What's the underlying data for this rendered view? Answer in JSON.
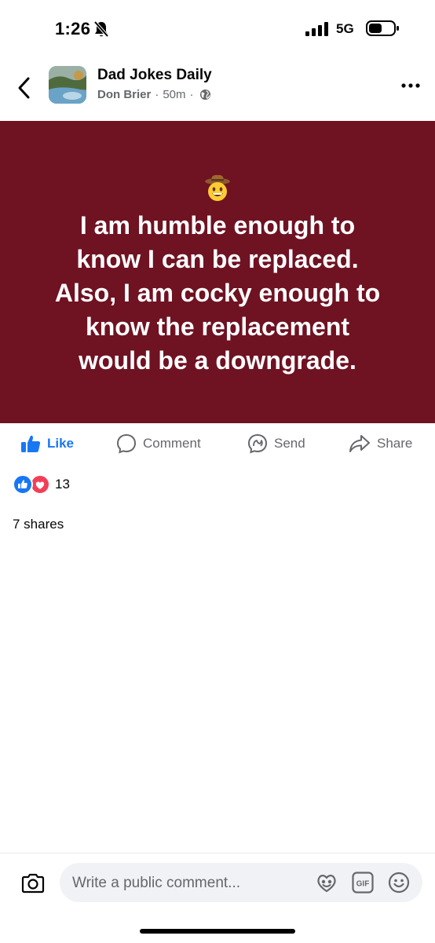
{
  "status_bar": {
    "time": "1:26",
    "network": "5G"
  },
  "header": {
    "group_name": "Dad Jokes Daily",
    "author": "Don Brier",
    "time_ago": "50m",
    "separator": "·"
  },
  "post": {
    "background_color": "#6f1222",
    "emoji": "cowboy-hat-face",
    "text": "I am humble enough to\nknow I can be replaced.\nAlso, I am cocky enough to\nknow the replacement\nwould be a downgrade."
  },
  "actions": {
    "like_label": "Like",
    "comment_label": "Comment",
    "send_label": "Send",
    "share_label": "Share"
  },
  "engagement": {
    "reaction_count": "13",
    "reaction_types": [
      "like",
      "love"
    ],
    "shares_text": "7 shares"
  },
  "comment_bar": {
    "placeholder": "Write a public comment...",
    "gif_label": "GIF"
  },
  "colors": {
    "accent": "#1877f2",
    "love": "#f33e58",
    "muted_text": "#65676b"
  }
}
